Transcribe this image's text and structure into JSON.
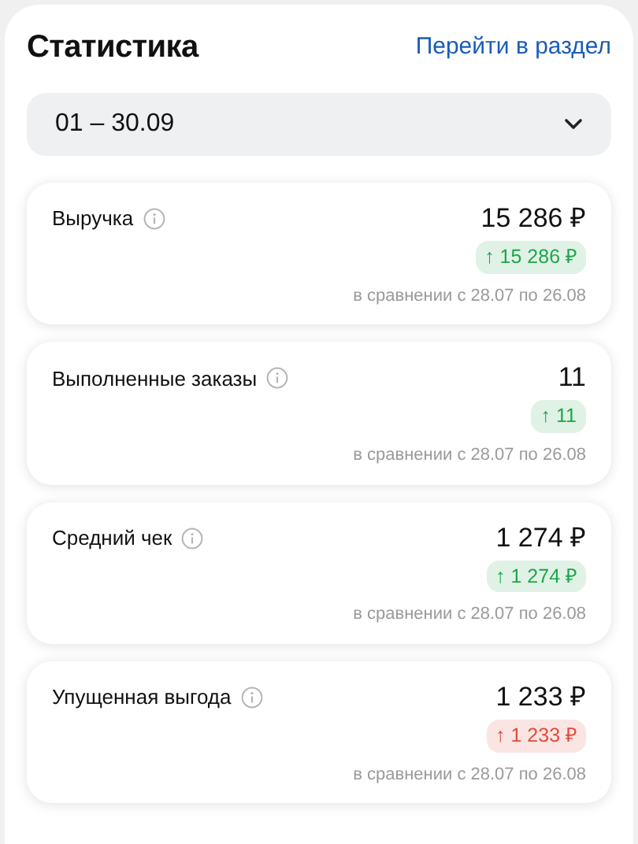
{
  "title": "Статистика",
  "link": "Перейти в раздел",
  "period": {
    "value": "01 – 30.09"
  },
  "metrics": [
    {
      "label": "Выручка",
      "value": "15 286 ₽",
      "change": "↑ 15 286 ₽",
      "color": "#1ea64a",
      "comparison": "в сравнении с 28.07 по 26.08"
    },
    {
      "label": "Выполненные заказы",
      "value": "11",
      "change": "↑ 11",
      "color": "#1ea64a",
      "comparison": "в сравнении с 28.07 по 26.08"
    },
    {
      "label": "Средний чек",
      "value": "1 274 ₽",
      "change": "↑ 1 274 ₽",
      "color": "#1ea64a",
      "comparison": "в сравнении с 28.07 по 26.08"
    },
    {
      "label": "Упущенная выгода",
      "value": "1 233 ₽",
      "change": "↑ 1 233 ₽",
      "color": "#e24a3b",
      "comparison": "в сравнении с 28.07 по 26.08"
    }
  ]
}
